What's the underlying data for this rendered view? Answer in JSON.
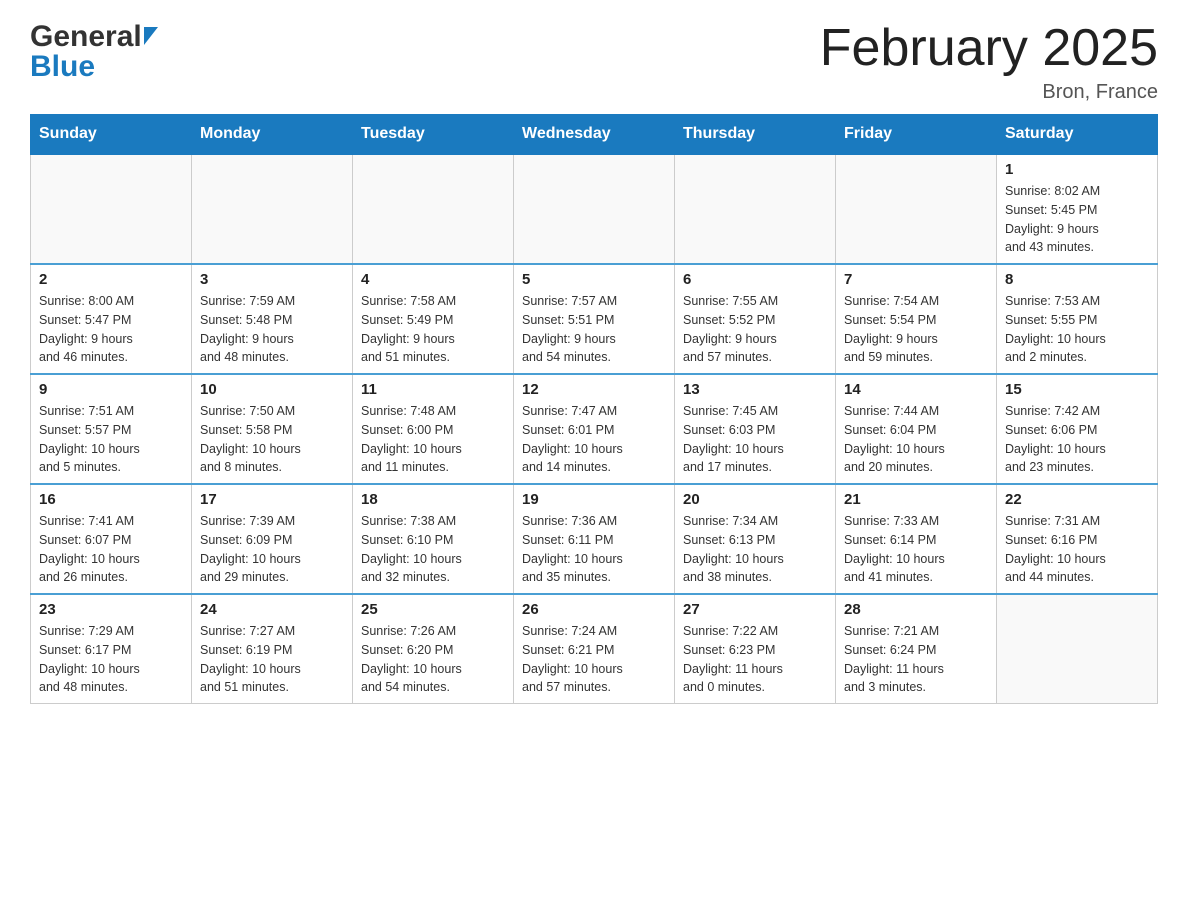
{
  "header": {
    "logo_line1": "General",
    "logo_line2": "Blue",
    "month_title": "February 2025",
    "location": "Bron, France"
  },
  "days_of_week": [
    "Sunday",
    "Monday",
    "Tuesday",
    "Wednesday",
    "Thursday",
    "Friday",
    "Saturday"
  ],
  "weeks": [
    {
      "days": [
        {
          "number": "",
          "info": "",
          "empty": true
        },
        {
          "number": "",
          "info": "",
          "empty": true
        },
        {
          "number": "",
          "info": "",
          "empty": true
        },
        {
          "number": "",
          "info": "",
          "empty": true
        },
        {
          "number": "",
          "info": "",
          "empty": true
        },
        {
          "number": "",
          "info": "",
          "empty": true
        },
        {
          "number": "1",
          "info": "Sunrise: 8:02 AM\nSunset: 5:45 PM\nDaylight: 9 hours\nand 43 minutes.",
          "empty": false
        }
      ]
    },
    {
      "days": [
        {
          "number": "2",
          "info": "Sunrise: 8:00 AM\nSunset: 5:47 PM\nDaylight: 9 hours\nand 46 minutes.",
          "empty": false
        },
        {
          "number": "3",
          "info": "Sunrise: 7:59 AM\nSunset: 5:48 PM\nDaylight: 9 hours\nand 48 minutes.",
          "empty": false
        },
        {
          "number": "4",
          "info": "Sunrise: 7:58 AM\nSunset: 5:49 PM\nDaylight: 9 hours\nand 51 minutes.",
          "empty": false
        },
        {
          "number": "5",
          "info": "Sunrise: 7:57 AM\nSunset: 5:51 PM\nDaylight: 9 hours\nand 54 minutes.",
          "empty": false
        },
        {
          "number": "6",
          "info": "Sunrise: 7:55 AM\nSunset: 5:52 PM\nDaylight: 9 hours\nand 57 minutes.",
          "empty": false
        },
        {
          "number": "7",
          "info": "Sunrise: 7:54 AM\nSunset: 5:54 PM\nDaylight: 9 hours\nand 59 minutes.",
          "empty": false
        },
        {
          "number": "8",
          "info": "Sunrise: 7:53 AM\nSunset: 5:55 PM\nDaylight: 10 hours\nand 2 minutes.",
          "empty": false
        }
      ]
    },
    {
      "days": [
        {
          "number": "9",
          "info": "Sunrise: 7:51 AM\nSunset: 5:57 PM\nDaylight: 10 hours\nand 5 minutes.",
          "empty": false
        },
        {
          "number": "10",
          "info": "Sunrise: 7:50 AM\nSunset: 5:58 PM\nDaylight: 10 hours\nand 8 minutes.",
          "empty": false
        },
        {
          "number": "11",
          "info": "Sunrise: 7:48 AM\nSunset: 6:00 PM\nDaylight: 10 hours\nand 11 minutes.",
          "empty": false
        },
        {
          "number": "12",
          "info": "Sunrise: 7:47 AM\nSunset: 6:01 PM\nDaylight: 10 hours\nand 14 minutes.",
          "empty": false
        },
        {
          "number": "13",
          "info": "Sunrise: 7:45 AM\nSunset: 6:03 PM\nDaylight: 10 hours\nand 17 minutes.",
          "empty": false
        },
        {
          "number": "14",
          "info": "Sunrise: 7:44 AM\nSunset: 6:04 PM\nDaylight: 10 hours\nand 20 minutes.",
          "empty": false
        },
        {
          "number": "15",
          "info": "Sunrise: 7:42 AM\nSunset: 6:06 PM\nDaylight: 10 hours\nand 23 minutes.",
          "empty": false
        }
      ]
    },
    {
      "days": [
        {
          "number": "16",
          "info": "Sunrise: 7:41 AM\nSunset: 6:07 PM\nDaylight: 10 hours\nand 26 minutes.",
          "empty": false
        },
        {
          "number": "17",
          "info": "Sunrise: 7:39 AM\nSunset: 6:09 PM\nDaylight: 10 hours\nand 29 minutes.",
          "empty": false
        },
        {
          "number": "18",
          "info": "Sunrise: 7:38 AM\nSunset: 6:10 PM\nDaylight: 10 hours\nand 32 minutes.",
          "empty": false
        },
        {
          "number": "19",
          "info": "Sunrise: 7:36 AM\nSunset: 6:11 PM\nDaylight: 10 hours\nand 35 minutes.",
          "empty": false
        },
        {
          "number": "20",
          "info": "Sunrise: 7:34 AM\nSunset: 6:13 PM\nDaylight: 10 hours\nand 38 minutes.",
          "empty": false
        },
        {
          "number": "21",
          "info": "Sunrise: 7:33 AM\nSunset: 6:14 PM\nDaylight: 10 hours\nand 41 minutes.",
          "empty": false
        },
        {
          "number": "22",
          "info": "Sunrise: 7:31 AM\nSunset: 6:16 PM\nDaylight: 10 hours\nand 44 minutes.",
          "empty": false
        }
      ]
    },
    {
      "days": [
        {
          "number": "23",
          "info": "Sunrise: 7:29 AM\nSunset: 6:17 PM\nDaylight: 10 hours\nand 48 minutes.",
          "empty": false
        },
        {
          "number": "24",
          "info": "Sunrise: 7:27 AM\nSunset: 6:19 PM\nDaylight: 10 hours\nand 51 minutes.",
          "empty": false
        },
        {
          "number": "25",
          "info": "Sunrise: 7:26 AM\nSunset: 6:20 PM\nDaylight: 10 hours\nand 54 minutes.",
          "empty": false
        },
        {
          "number": "26",
          "info": "Sunrise: 7:24 AM\nSunset: 6:21 PM\nDaylight: 10 hours\nand 57 minutes.",
          "empty": false
        },
        {
          "number": "27",
          "info": "Sunrise: 7:22 AM\nSunset: 6:23 PM\nDaylight: 11 hours\nand 0 minutes.",
          "empty": false
        },
        {
          "number": "28",
          "info": "Sunrise: 7:21 AM\nSunset: 6:24 PM\nDaylight: 11 hours\nand 3 minutes.",
          "empty": false
        },
        {
          "number": "",
          "info": "",
          "empty": true
        }
      ]
    }
  ]
}
